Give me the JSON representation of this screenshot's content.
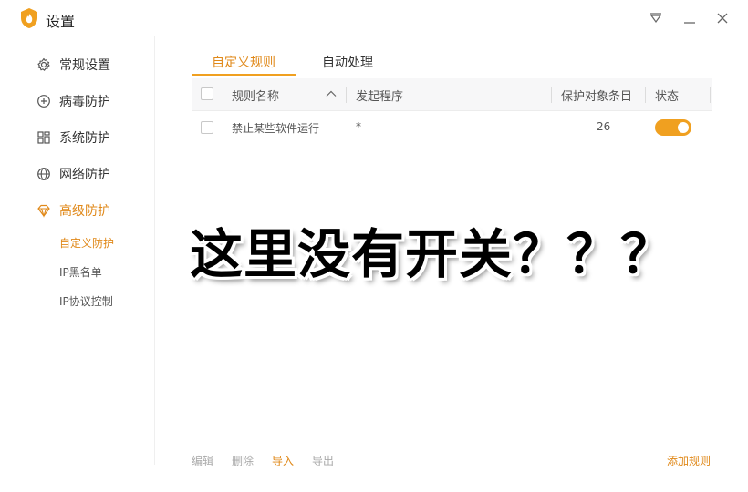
{
  "window": {
    "title": "设置",
    "logo_icon": "shield-flame-icon",
    "controls": [
      "menu-down-icon",
      "minimize-icon",
      "close-icon"
    ]
  },
  "colors": {
    "accent": "#f0a020",
    "accent_text": "#e0891a"
  },
  "sidebar": {
    "items": [
      {
        "label": "常规设置",
        "icon": "gear-icon"
      },
      {
        "label": "病毒防护",
        "icon": "plus-square-icon"
      },
      {
        "label": "系统防护",
        "icon": "grid-icon"
      },
      {
        "label": "网络防护",
        "icon": "globe-icon"
      },
      {
        "label": "高级防护",
        "icon": "diamond-icon",
        "active": true
      }
    ],
    "sub_items": [
      {
        "label": "自定义防护",
        "active": true
      },
      {
        "label": "IP黑名单"
      },
      {
        "label": "IP协议控制"
      }
    ]
  },
  "tabs": [
    {
      "label": "自定义规则",
      "active": true
    },
    {
      "label": "自动处理"
    }
  ],
  "table": {
    "headers": [
      "规则名称",
      "发起程序",
      "保护对象条目",
      "状态"
    ],
    "rows": [
      {
        "name": "禁止某些软件运行",
        "program": "*",
        "count": "26",
        "enabled": true
      }
    ]
  },
  "annotation": "这里没有开关？？？",
  "footer": {
    "actions": [
      {
        "label": "编辑",
        "enabled": false
      },
      {
        "label": "删除",
        "enabled": false
      },
      {
        "label": "导入",
        "enabled": true
      },
      {
        "label": "导出",
        "enabled": false
      }
    ],
    "add_rule": "添加规则"
  }
}
